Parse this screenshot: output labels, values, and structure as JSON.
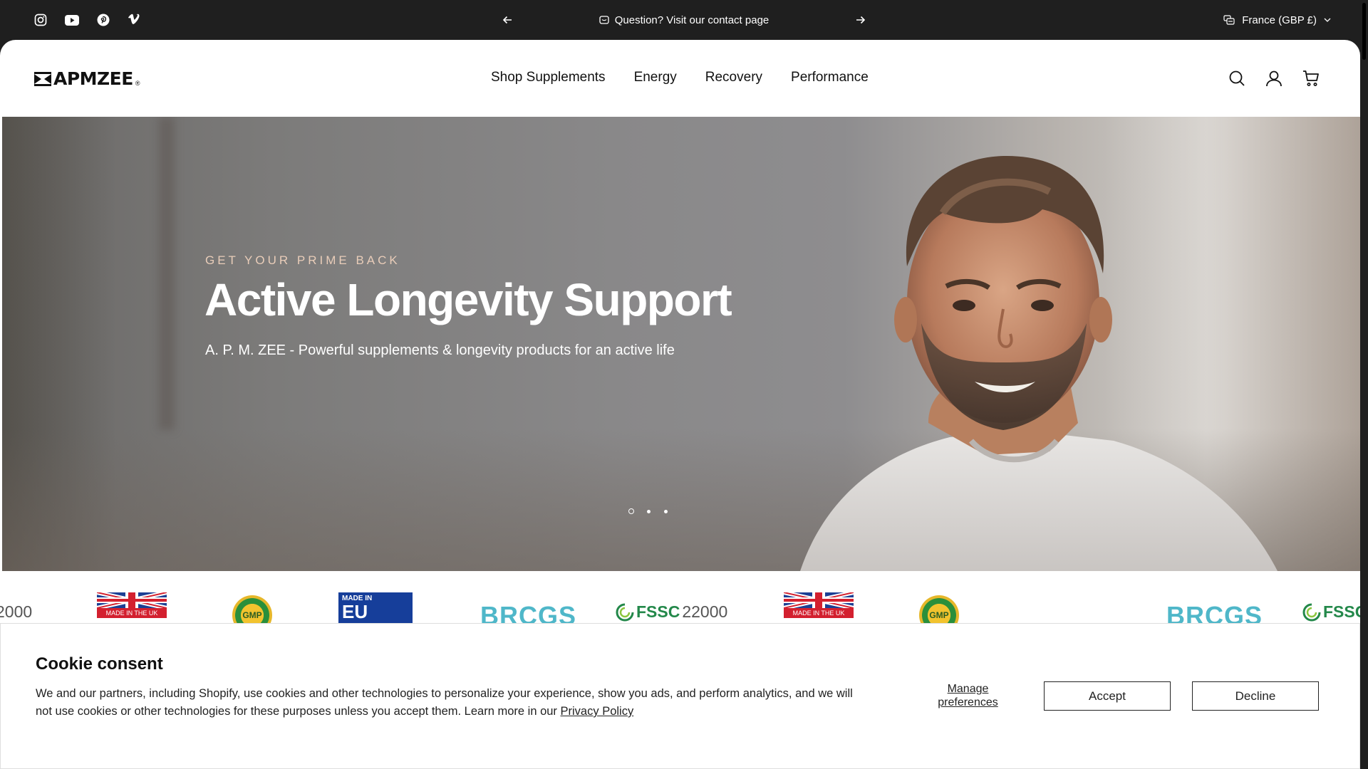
{
  "topbar": {
    "social": [
      {
        "name": "instagram-icon"
      },
      {
        "name": "youtube-icon"
      },
      {
        "name": "pinterest-icon"
      },
      {
        "name": "vimeo-icon"
      }
    ],
    "announcement": "Question? Visit our contact page",
    "locale": "France (GBP £)"
  },
  "header": {
    "logo_text": "APMZEE",
    "logo_mark": "®",
    "nav": [
      "Shop Supplements",
      "Energy",
      "Recovery",
      "Performance"
    ]
  },
  "hero": {
    "tagline": "GET YOUR PRIME BACK",
    "title": "Active Longevity Support",
    "subtitle": "A. P. M. ZEE - Powerful supplements & longevity products for an active life",
    "slides_total": 3,
    "active_slide": 1
  },
  "certifications": {
    "made_in_uk": "MADE IN THE UK",
    "gmp": "GMP",
    "made_in_eu_top": "MADE IN",
    "made_in_eu_big": "EU",
    "brcgs": "BRCGS",
    "fssc": "FSSC",
    "fssc_num": "22000",
    "fssc_num_partial": "2000"
  },
  "cookie": {
    "title": "Cookie consent",
    "body": "We and our partners, including Shopify, use cookies and other technologies to personalize your experience, show you ads, and perform analytics, and we will not use cookies or other technologies for these purposes unless you accept them. Learn more in our ",
    "privacy_link": "Privacy Policy",
    "manage": "Manage preferences",
    "accept": "Accept",
    "decline": "Decline"
  },
  "colors": {
    "topbar_bg": "#1f1f1f",
    "tagline": "#e9cdb9",
    "uk_red": "#d3202f",
    "eu_blue": "#163e9a",
    "brcgs_teal": "#4fb7c9",
    "fssc_green": "#23884a"
  }
}
